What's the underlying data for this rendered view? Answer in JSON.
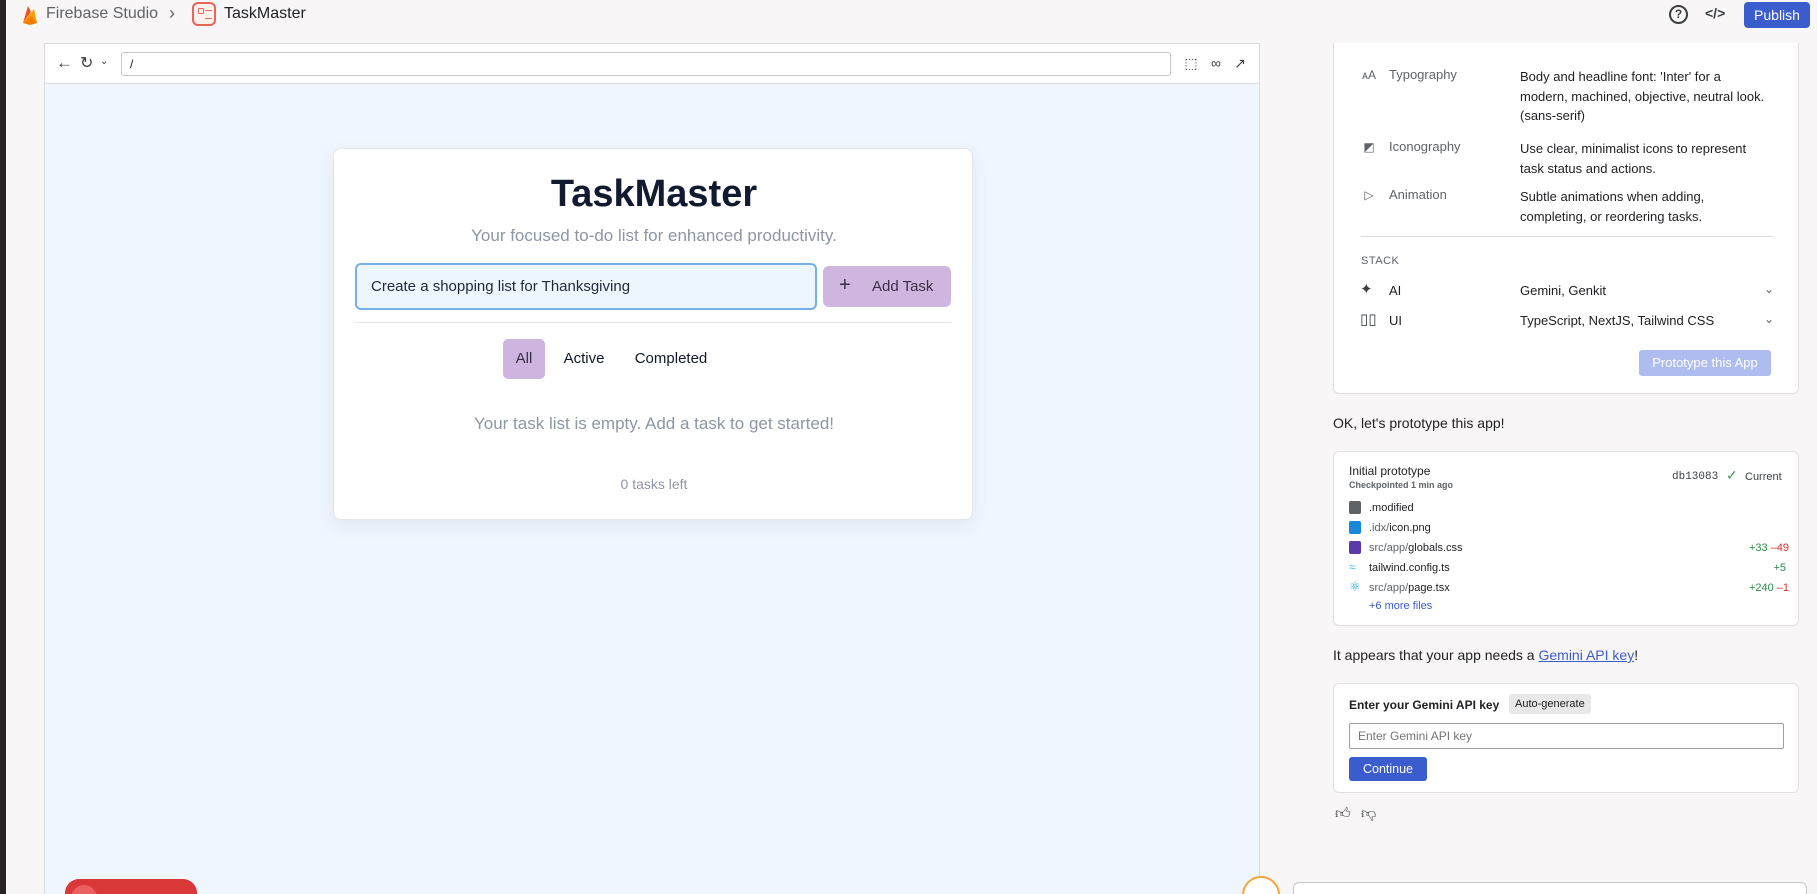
{
  "header": {
    "brand": "Firebase Studio",
    "separator": ">",
    "app_name": "TaskMaster",
    "publish_label": "Publish"
  },
  "preview": {
    "url": "/",
    "app": {
      "title": "TaskMaster",
      "subtitle": "Your focused to-do list for enhanced productivity.",
      "task_input_value": "Create a shopping list for Thanksgiving",
      "add_button_label": "Add Task",
      "filters": [
        "All",
        "Active",
        "Completed"
      ],
      "selected_filter": "All",
      "empty_message": "Your task list is empty. Add a task to get started!",
      "tasks_left": "0 tasks left"
    }
  },
  "blueprint": {
    "features": [
      {
        "icon": "typography-icon",
        "label": "Typography",
        "desc": "Body and headline font: 'Inter' for a modern, machined, objective, neutral look. (sans-serif)"
      },
      {
        "icon": "iconography-icon",
        "label": "Iconography",
        "desc": "Use clear, minimalist icons to represent task status and actions."
      },
      {
        "icon": "animation-icon",
        "label": "Animation",
        "desc": "Subtle animations when adding, completing, or reordering tasks."
      }
    ],
    "stack_heading": "STACK",
    "stack": [
      {
        "label": "AI",
        "value": "Gemini, Genkit"
      },
      {
        "label": "UI",
        "value": "TypeScript, NextJS, Tailwind CSS"
      }
    ],
    "prototype_button": "Prototype this App"
  },
  "chat": {
    "message_1": "OK, let's prototype this app!",
    "checkpoint": {
      "title": "Initial prototype",
      "subtitle": "Checkpointed 1 min ago",
      "hash": "db13083",
      "status": "Current",
      "files": [
        {
          "dir": "",
          "name": ".modified",
          "added": "",
          "removed": "",
          "icon_color": "#5f6368"
        },
        {
          "dir": ".idx/",
          "name": "icon.png",
          "added": "",
          "removed": "",
          "icon_color": "#1a88d8"
        },
        {
          "dir": "src/app/",
          "name": "globals.css",
          "added": "+33",
          "removed": "–49",
          "icon_color": "#5b3ba8"
        },
        {
          "dir": "",
          "name": "tailwind.config.ts",
          "added": "+5",
          "removed": "",
          "icon_color": "#38bdf8"
        },
        {
          "dir": "src/app/",
          "name": "page.tsx",
          "added": "+240",
          "removed": "–1",
          "icon_color": "#1ea7d6"
        }
      ],
      "more_files": "+6 more files"
    },
    "message_2_prefix": "It appears that your app needs a ",
    "message_2_link": "Gemini API key",
    "message_2_suffix": "!",
    "api_key": {
      "label": "Enter your Gemini API key",
      "auto_generate": "Auto-generate",
      "placeholder": "Enter Gemini API key",
      "continue_label": "Continue"
    }
  },
  "colors": {
    "accent": "#3b5ccc",
    "app_accent": "#cdb5df",
    "preview_bg": "#f0f6fd"
  }
}
